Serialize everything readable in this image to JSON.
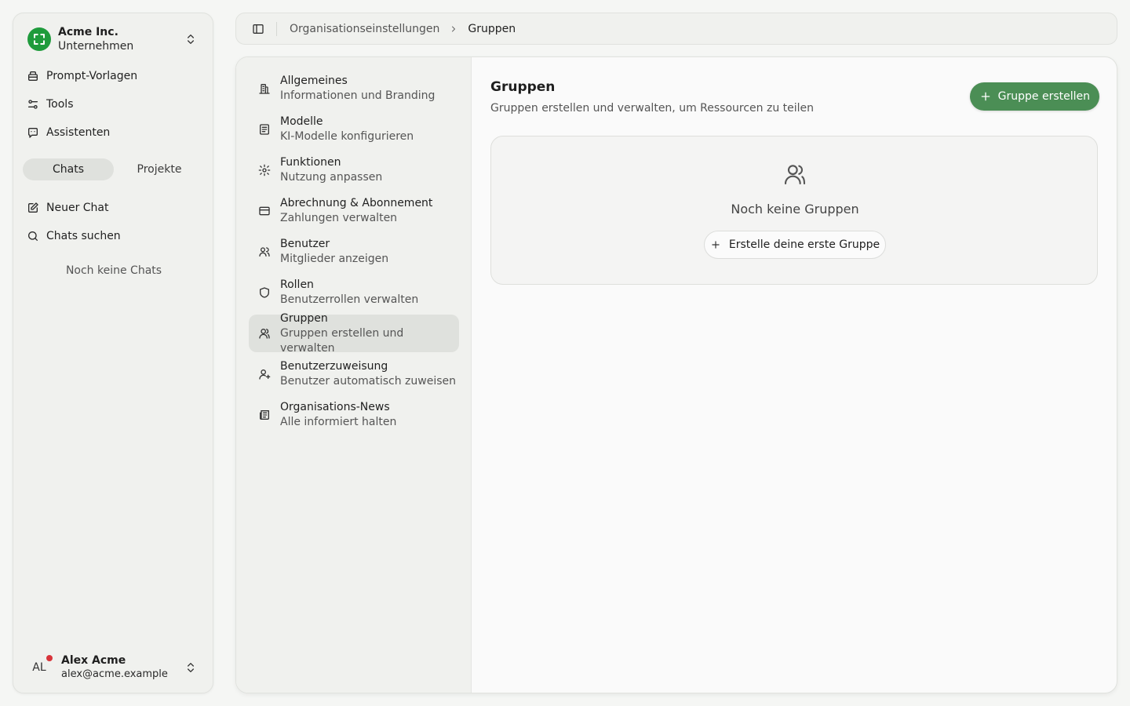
{
  "org": {
    "name": "Acme Inc.",
    "type": "Unternehmen"
  },
  "sidebar": {
    "nav": [
      {
        "label": "Prompt-Vorlagen",
        "icon": "prompt-template-icon"
      },
      {
        "label": "Tools",
        "icon": "tools-icon"
      },
      {
        "label": "Assistenten",
        "icon": "assistant-icon"
      }
    ],
    "tabs": [
      {
        "label": "Chats",
        "active": true
      },
      {
        "label": "Projekte",
        "active": false
      }
    ],
    "actions": [
      {
        "label": "Neuer Chat",
        "icon": "new-chat-icon"
      },
      {
        "label": "Chats suchen",
        "icon": "search-icon"
      }
    ],
    "empty_text": "Noch keine Chats"
  },
  "user": {
    "initials": "AL",
    "name": "Alex Acme",
    "email": "alex@acme.example"
  },
  "breadcrumb": {
    "parent": "Organisationseinstellungen",
    "current": "Gruppen"
  },
  "settings_nav": [
    {
      "title": "Allgemeines",
      "subtitle": "Informationen und Branding",
      "icon": "building-icon"
    },
    {
      "title": "Modelle",
      "subtitle": "KI-Modelle konfigurieren",
      "icon": "model-icon"
    },
    {
      "title": "Funktionen",
      "subtitle": "Nutzung anpassen",
      "icon": "gear-icon"
    },
    {
      "title": "Abrechnung & Abonnement",
      "subtitle": "Zahlungen verwalten",
      "icon": "credit-card-icon"
    },
    {
      "title": "Benutzer",
      "subtitle": "Mitglieder anzeigen",
      "icon": "users-icon"
    },
    {
      "title": "Rollen",
      "subtitle": "Benutzerrollen verwalten",
      "icon": "shield-icon"
    },
    {
      "title": "Gruppen",
      "subtitle": "Gruppen erstellen und verwalten",
      "icon": "group-icon",
      "active": true
    },
    {
      "title": "Benutzerzuweisung",
      "subtitle": "Benutzer automatisch zuweisen",
      "icon": "user-plus-icon"
    },
    {
      "title": "Organisations-News",
      "subtitle": "Alle informiert halten",
      "icon": "newspaper-icon"
    }
  ],
  "page": {
    "title": "Gruppen",
    "subtitle": "Gruppen erstellen und verwalten, um Ressourcen zu teilen",
    "create_button": "Gruppe erstellen",
    "empty_title": "Noch keine Gruppen",
    "empty_button": "Erstelle deine erste Gruppe"
  },
  "colors": {
    "accent": "#4b8e55",
    "logo": "#1f9b3c",
    "notification": "#d8343a"
  }
}
